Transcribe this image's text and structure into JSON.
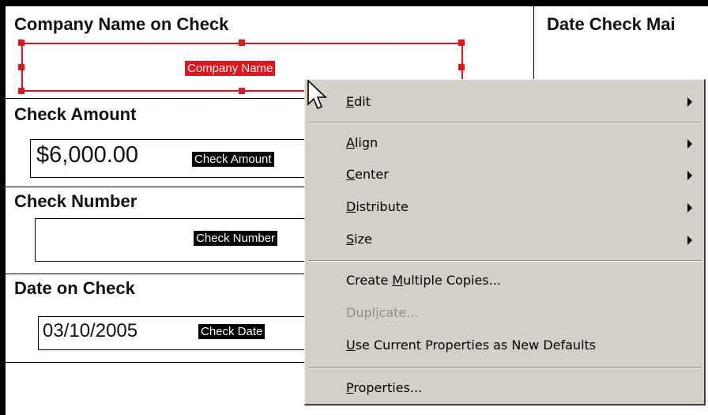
{
  "form": {
    "sections": [
      {
        "heading": "Company Name on Check",
        "tag": "Company Name"
      },
      {
        "heading": "Check Amount",
        "value": "$6,000.00",
        "tag": "Check Amount"
      },
      {
        "heading": "Check Number",
        "value": "",
        "tag": "Check Number"
      },
      {
        "heading": "Date on Check",
        "value": "03/10/2005",
        "tag": "Check Date"
      }
    ],
    "right_heading": "Date Check Mai",
    "selection_color": "#e5141c"
  },
  "context_menu": {
    "items": [
      {
        "pre": "",
        "ul": "E",
        "post": "dit",
        "submenu": true,
        "enabled": true
      },
      {
        "pre": "",
        "ul": "A",
        "post": "lign",
        "submenu": true,
        "enabled": true
      },
      {
        "pre": "",
        "ul": "C",
        "post": "enter",
        "submenu": true,
        "enabled": true
      },
      {
        "pre": "",
        "ul": "D",
        "post": "istribute",
        "submenu": true,
        "enabled": true
      },
      {
        "pre": "",
        "ul": "S",
        "post": "ize",
        "submenu": true,
        "enabled": true
      },
      {
        "pre": "Create ",
        "ul": "M",
        "post": "ultiple Copies...",
        "submenu": false,
        "enabled": true
      },
      {
        "pre": "Dupl",
        "ul": "i",
        "post": "cate...",
        "submenu": false,
        "enabled": false
      },
      {
        "pre": "",
        "ul": "U",
        "post": "se Current Properties as New Defaults",
        "submenu": false,
        "enabled": true
      },
      {
        "pre": "",
        "ul": "P",
        "post": "roperties...",
        "submenu": false,
        "enabled": true
      }
    ]
  }
}
